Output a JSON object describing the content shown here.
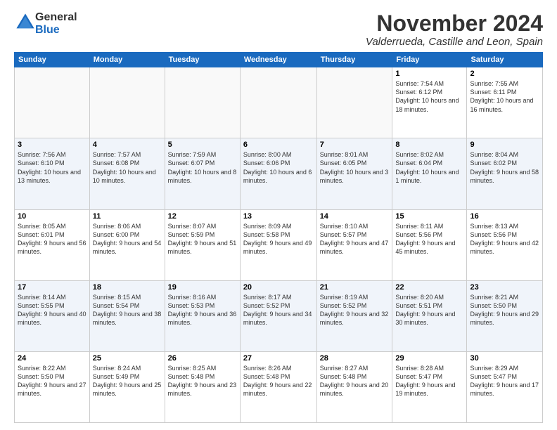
{
  "logo": {
    "general": "General",
    "blue": "Blue"
  },
  "title": {
    "month": "November 2024",
    "location": "Valderrueda, Castille and Leon, Spain"
  },
  "weekdays": [
    "Sunday",
    "Monday",
    "Tuesday",
    "Wednesday",
    "Thursday",
    "Friday",
    "Saturday"
  ],
  "weeks": [
    [
      {
        "day": "",
        "info": ""
      },
      {
        "day": "",
        "info": ""
      },
      {
        "day": "",
        "info": ""
      },
      {
        "day": "",
        "info": ""
      },
      {
        "day": "",
        "info": ""
      },
      {
        "day": "1",
        "info": "Sunrise: 7:54 AM\nSunset: 6:12 PM\nDaylight: 10 hours and 18 minutes."
      },
      {
        "day": "2",
        "info": "Sunrise: 7:55 AM\nSunset: 6:11 PM\nDaylight: 10 hours and 16 minutes."
      }
    ],
    [
      {
        "day": "3",
        "info": "Sunrise: 7:56 AM\nSunset: 6:10 PM\nDaylight: 10 hours and 13 minutes."
      },
      {
        "day": "4",
        "info": "Sunrise: 7:57 AM\nSunset: 6:08 PM\nDaylight: 10 hours and 10 minutes."
      },
      {
        "day": "5",
        "info": "Sunrise: 7:59 AM\nSunset: 6:07 PM\nDaylight: 10 hours and 8 minutes."
      },
      {
        "day": "6",
        "info": "Sunrise: 8:00 AM\nSunset: 6:06 PM\nDaylight: 10 hours and 6 minutes."
      },
      {
        "day": "7",
        "info": "Sunrise: 8:01 AM\nSunset: 6:05 PM\nDaylight: 10 hours and 3 minutes."
      },
      {
        "day": "8",
        "info": "Sunrise: 8:02 AM\nSunset: 6:04 PM\nDaylight: 10 hours and 1 minute."
      },
      {
        "day": "9",
        "info": "Sunrise: 8:04 AM\nSunset: 6:02 PM\nDaylight: 9 hours and 58 minutes."
      }
    ],
    [
      {
        "day": "10",
        "info": "Sunrise: 8:05 AM\nSunset: 6:01 PM\nDaylight: 9 hours and 56 minutes."
      },
      {
        "day": "11",
        "info": "Sunrise: 8:06 AM\nSunset: 6:00 PM\nDaylight: 9 hours and 54 minutes."
      },
      {
        "day": "12",
        "info": "Sunrise: 8:07 AM\nSunset: 5:59 PM\nDaylight: 9 hours and 51 minutes."
      },
      {
        "day": "13",
        "info": "Sunrise: 8:09 AM\nSunset: 5:58 PM\nDaylight: 9 hours and 49 minutes."
      },
      {
        "day": "14",
        "info": "Sunrise: 8:10 AM\nSunset: 5:57 PM\nDaylight: 9 hours and 47 minutes."
      },
      {
        "day": "15",
        "info": "Sunrise: 8:11 AM\nSunset: 5:56 PM\nDaylight: 9 hours and 45 minutes."
      },
      {
        "day": "16",
        "info": "Sunrise: 8:13 AM\nSunset: 5:56 PM\nDaylight: 9 hours and 42 minutes."
      }
    ],
    [
      {
        "day": "17",
        "info": "Sunrise: 8:14 AM\nSunset: 5:55 PM\nDaylight: 9 hours and 40 minutes."
      },
      {
        "day": "18",
        "info": "Sunrise: 8:15 AM\nSunset: 5:54 PM\nDaylight: 9 hours and 38 minutes."
      },
      {
        "day": "19",
        "info": "Sunrise: 8:16 AM\nSunset: 5:53 PM\nDaylight: 9 hours and 36 minutes."
      },
      {
        "day": "20",
        "info": "Sunrise: 8:17 AM\nSunset: 5:52 PM\nDaylight: 9 hours and 34 minutes."
      },
      {
        "day": "21",
        "info": "Sunrise: 8:19 AM\nSunset: 5:52 PM\nDaylight: 9 hours and 32 minutes."
      },
      {
        "day": "22",
        "info": "Sunrise: 8:20 AM\nSunset: 5:51 PM\nDaylight: 9 hours and 30 minutes."
      },
      {
        "day": "23",
        "info": "Sunrise: 8:21 AM\nSunset: 5:50 PM\nDaylight: 9 hours and 29 minutes."
      }
    ],
    [
      {
        "day": "24",
        "info": "Sunrise: 8:22 AM\nSunset: 5:50 PM\nDaylight: 9 hours and 27 minutes."
      },
      {
        "day": "25",
        "info": "Sunrise: 8:24 AM\nSunset: 5:49 PM\nDaylight: 9 hours and 25 minutes."
      },
      {
        "day": "26",
        "info": "Sunrise: 8:25 AM\nSunset: 5:48 PM\nDaylight: 9 hours and 23 minutes."
      },
      {
        "day": "27",
        "info": "Sunrise: 8:26 AM\nSunset: 5:48 PM\nDaylight: 9 hours and 22 minutes."
      },
      {
        "day": "28",
        "info": "Sunrise: 8:27 AM\nSunset: 5:48 PM\nDaylight: 9 hours and 20 minutes."
      },
      {
        "day": "29",
        "info": "Sunrise: 8:28 AM\nSunset: 5:47 PM\nDaylight: 9 hours and 19 minutes."
      },
      {
        "day": "30",
        "info": "Sunrise: 8:29 AM\nSunset: 5:47 PM\nDaylight: 9 hours and 17 minutes."
      }
    ]
  ]
}
